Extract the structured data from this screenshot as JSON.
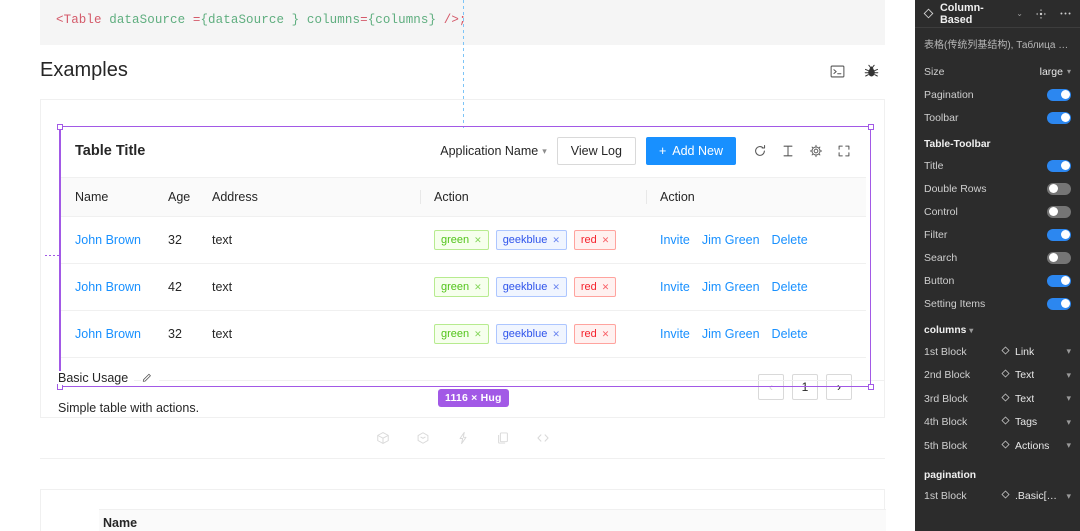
{
  "canvas": {
    "code_snippet": {
      "tag_open": "<Table",
      "attr1": "dataSource",
      "eq1": " =",
      "val1": "{dataSource }",
      "attr2": "columns",
      "eq2": "=",
      "val2": "{columns}",
      "tag_close": "/>;"
    },
    "section_title": "Examples",
    "header_icons": [
      "console-icon",
      "bug-icon"
    ],
    "table": {
      "title": "Table Title",
      "filter_label": "Application Name",
      "view_log_label": "View Log",
      "add_new_label": "Add New",
      "add_new_plus": "+",
      "toolbar_icons": [
        "reload-icon",
        "column-height-icon",
        "setting-icon",
        "fullscreen-icon"
      ],
      "columns": [
        "Name",
        "Age",
        "Address",
        "Action",
        "Action"
      ],
      "rows": [
        {
          "name": "John Brown",
          "age": "32",
          "address": "text",
          "tags": [
            {
              "label": "green",
              "style": "green"
            },
            {
              "label": "geekblue",
              "style": "geekblue"
            },
            {
              "label": "red",
              "style": "red"
            }
          ],
          "actions": [
            "Invite",
            "Jim Green",
            "Delete"
          ]
        },
        {
          "name": "John Brown",
          "age": "42",
          "address": "text",
          "tags": [
            {
              "label": "green",
              "style": "green"
            },
            {
              "label": "geekblue",
              "style": "geekblue"
            },
            {
              "label": "red",
              "style": "red"
            }
          ],
          "actions": [
            "Invite",
            "Jim Green",
            "Delete"
          ]
        },
        {
          "name": "John Brown",
          "age": "32",
          "address": "text",
          "tags": [
            {
              "label": "green",
              "style": "green"
            },
            {
              "label": "geekblue",
              "style": "geekblue"
            },
            {
              "label": "red",
              "style": "red"
            }
          ],
          "actions": [
            "Invite",
            "Jim Green",
            "Delete"
          ]
        }
      ],
      "pagination": {
        "prev": "‹",
        "page": "1",
        "next": "›"
      }
    },
    "caption": {
      "title": "Basic Usage",
      "edit_icon": "pencil-icon",
      "description": "Simple table with actions."
    },
    "bottom_icons": [
      "cube-icon",
      "box-icon",
      "lightning-icon",
      "copy-icon",
      "code-icon"
    ],
    "next_section": {
      "header_label": "Name"
    },
    "selection": {
      "size_badge": "1116 × Hug",
      "accent": "#a259e6"
    }
  },
  "panel": {
    "header": {
      "component_icon": "component-diamond-icon",
      "title": "Column-Based",
      "caret": "⌄",
      "swap_icon": "swap-component-icon",
      "more_icon": "more-horizontal-icon"
    },
    "description": "表格(传统列基结构), Таблица Table - ...",
    "top_props": [
      {
        "label": "Size",
        "type": "select",
        "value": "large"
      },
      {
        "label": "Pagination",
        "type": "toggle",
        "value": "on"
      },
      {
        "label": "Toolbar",
        "type": "toggle",
        "value": "on"
      }
    ],
    "toolbar_group": {
      "title": "Table-Toolbar",
      "items": [
        {
          "label": "Title",
          "value": "on"
        },
        {
          "label": "Double Rows",
          "value": "off"
        },
        {
          "label": "Control",
          "value": "off"
        },
        {
          "label": "Filter",
          "value": "on"
        },
        {
          "label": "Search",
          "value": "off"
        },
        {
          "label": "Button",
          "value": "on"
        },
        {
          "label": "Setting Items",
          "value": "on"
        }
      ]
    },
    "columns_group": {
      "title": "columns",
      "caret": "▾",
      "items": [
        {
          "label": "1st Block",
          "value": "Link"
        },
        {
          "label": "2nd Block",
          "value": "Text"
        },
        {
          "label": "3rd Block",
          "value": "Text"
        },
        {
          "label": "4th Block",
          "value": "Tags"
        },
        {
          "label": "5th Block",
          "value": "Actions"
        }
      ]
    },
    "pagination_group": {
      "title": "pagination",
      "items": [
        {
          "label": "1st Block",
          "value": ".Basic[Le..."
        }
      ]
    },
    "colors": {
      "toggle_on": "#2c87f0",
      "toggle_off": "#757575",
      "bg": "#2c2c2c"
    }
  }
}
